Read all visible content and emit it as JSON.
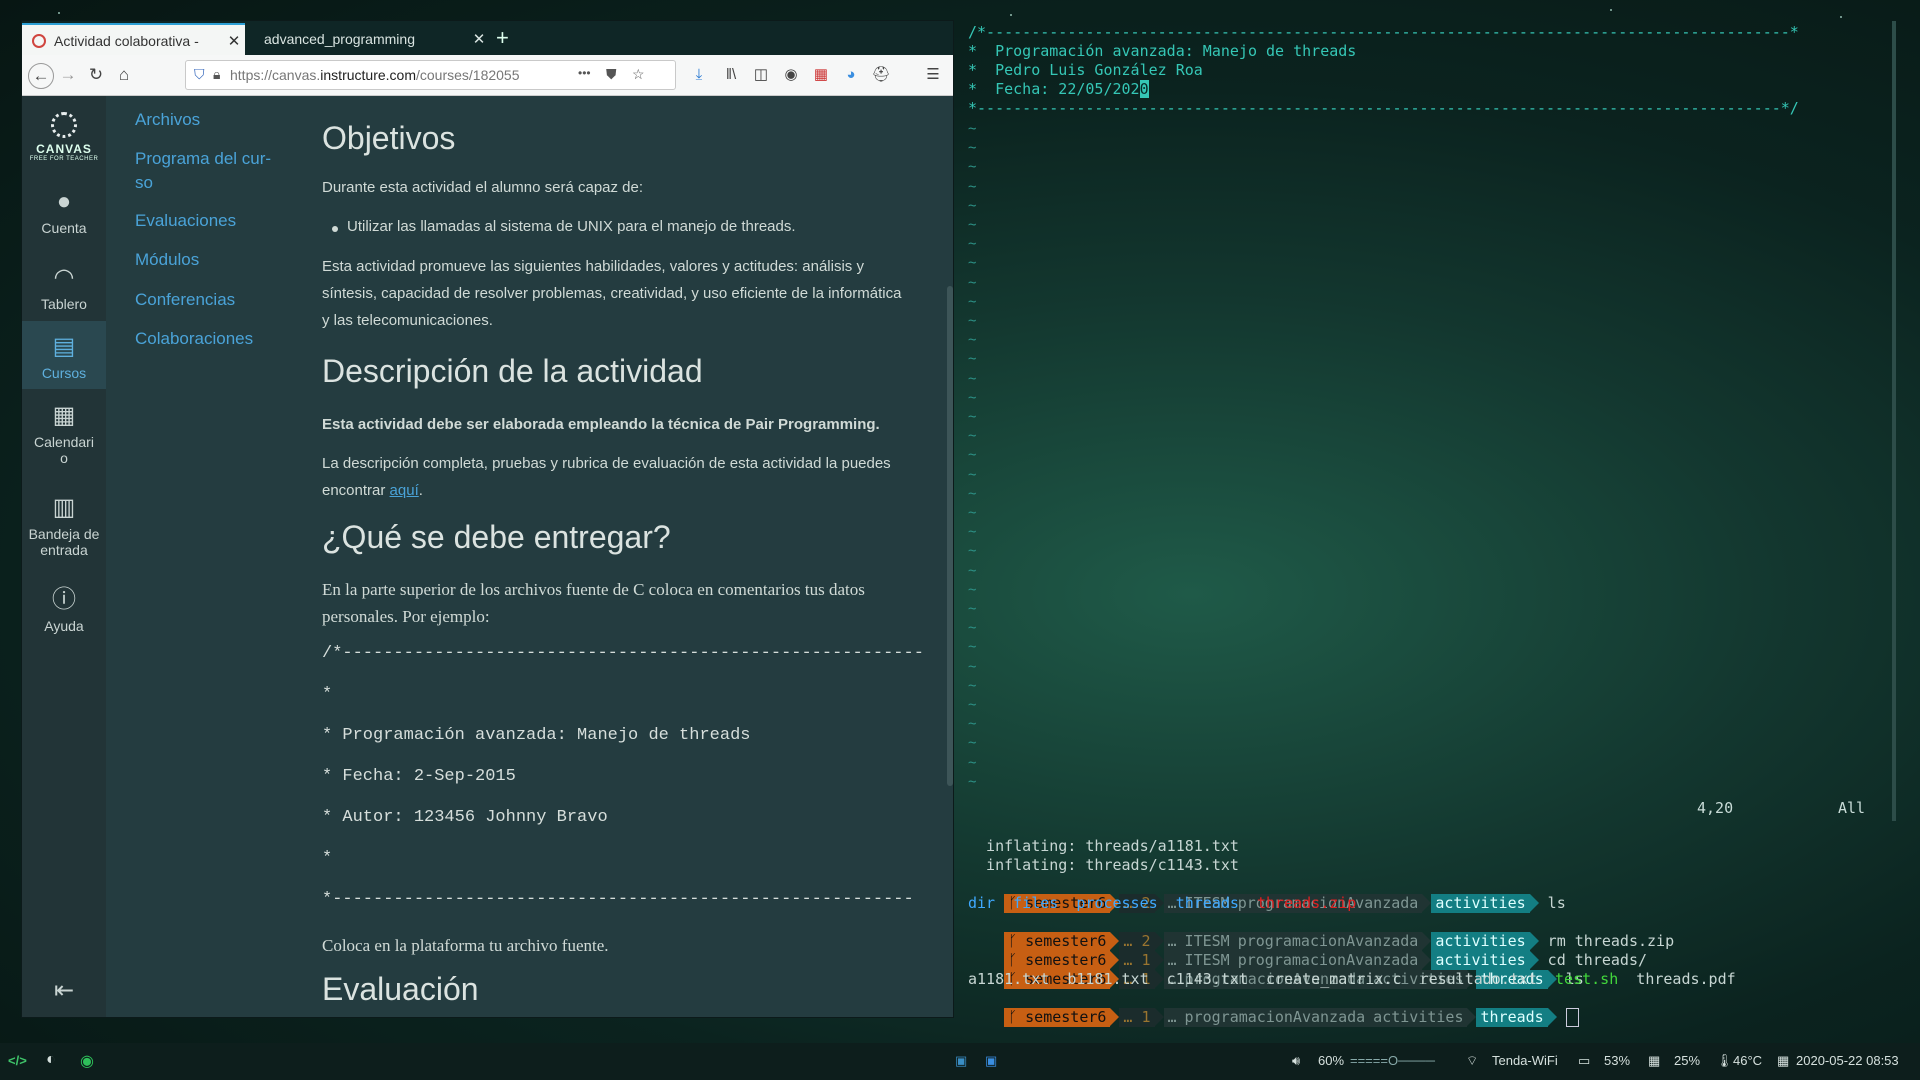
{
  "browser": {
    "tabs": [
      {
        "title": "Actividad colaborativa - ",
        "active": true
      },
      {
        "title": "advanced_programming",
        "active": false
      }
    ],
    "new_tab": "+",
    "url_prefix": "https://canvas.",
    "url_domain": "instructure.com",
    "url_rest": "/courses/182055",
    "url_more": "•••"
  },
  "canvas_nav": {
    "logo": "CANVAS",
    "logo_sub": "FREE FOR TEACHER",
    "items": [
      {
        "label": "Cuenta",
        "icon": "user"
      },
      {
        "label": "Tablero",
        "icon": "dashboard"
      },
      {
        "label": "Cursos",
        "icon": "book"
      },
      {
        "label": "Calendari o",
        "icon": "calendar"
      },
      {
        "label": "Bandeja de entrada",
        "icon": "inbox"
      },
      {
        "label": "Ayuda",
        "icon": "help"
      }
    ],
    "collapse": "⇤"
  },
  "course_nav": {
    "items": [
      "Archivos",
      "Programa del cur- so",
      "Evaluaciones",
      "Módulos",
      "Conferencias",
      "Colaboraciones"
    ]
  },
  "content": {
    "h_objetivos": "Objetivos",
    "intro": "Durante esta actividad el alumno será capaz de:",
    "bullet1": "Utilizar las llamadas al sistema de UNIX para el manejo de threads.",
    "habilidades": "Esta actividad promueve las siguientes habilidades, valores y actitudes: análisis y síntesis, capacidad de resolver problemas, creatividad, y uso eficiente de la informática y las telecomunicaciones.",
    "h_descripcion": "Descripción de la actividad",
    "pair": "Esta actividad debe ser elaborada empleando la técnica de Pair Programming.",
    "desc_a": "La descripción completa, pruebas y rubrica de evaluación de esta actividad la puedes encontrar ",
    "desc_link": "aquí",
    "desc_b": ".",
    "h_entregar": "¿Qué se debe entregar?",
    "entregar_p": "En la parte superior de los archivos fuente de C coloca en comentarios tus datos personales. Por ejemplo:",
    "code": [
      "/*---------------------------------------------------------",
      "*",
      "* Programación avanzada: Manejo de threads",
      "* Fecha: 2-Sep-2015",
      "* Autor: 123456 Johnny Bravo",
      "*",
      "*---------------------------------------------------------"
    ],
    "coloca": "Coloca en la plataforma tu archivo fuente.",
    "h_evaluacion": "Evaluación"
  },
  "terminal": {
    "vim_lines": [
      "/*-----------------------------------------------------------------------------------------*",
      "*  Programación avanzada: Manejo de threads",
      "*  Pedro Luis González Roa",
      "*  Fecha: 22/05/202",
      "*-----------------------------------------------------------------------------------------*/"
    ],
    "vim_cursor_char": "0",
    "tilde": "~",
    "ruler_pos": "4,20",
    "ruler_all": "All",
    "inflate1": "  inflating: threads/a1181.txt",
    "inflate2": "  inflating: threads/c1143.txt",
    "prompt_user": "semester6",
    "ellipsis": "…",
    "jobs2": "2",
    "jobs1": "1",
    "path": [
      "ITESM",
      "programacionAvanzada",
      "activities",
      "threads"
    ],
    "cmd_ls": "ls",
    "cmd_rm": "rm threads.zip",
    "cmd_cd": "cd threads/",
    "ls1_dirs": [
      "dir",
      "files",
      "processes",
      "threads"
    ],
    "ls1_zip": "threads.zip",
    "ls2_files": "a1181.txt  b1181.txt  c1143.txt  create_matrix.c  resultado.txt",
    "ls2_sh": "test.sh",
    "ls2_pdf": "threads.pdf"
  },
  "statusbar": {
    "volume": "60%",
    "volume_bar": "=====O────",
    "wifi": "Tenda-WiFi",
    "battery": "53%",
    "memory": "25%",
    "temp": "46°C",
    "datetime": "2020-05-22 08:53"
  },
  "colors": {
    "accent": "#35c7b6",
    "link": "#4aa3d8",
    "prompt_orange": "#c75f13",
    "prompt_teal": "#137e83"
  }
}
